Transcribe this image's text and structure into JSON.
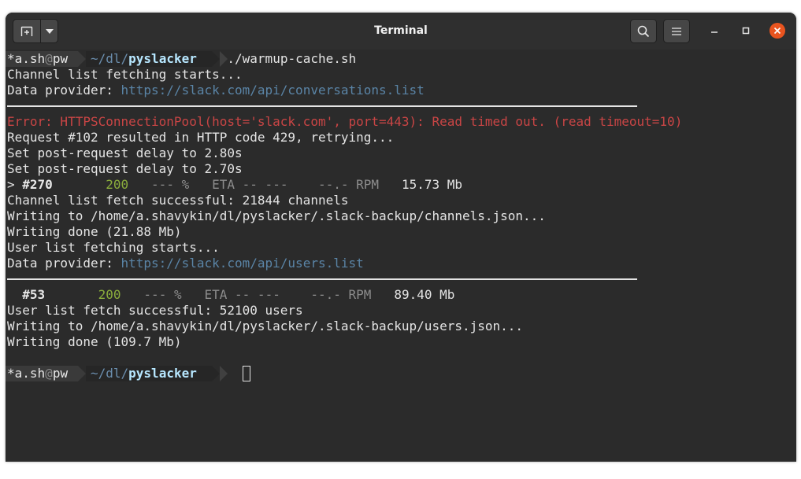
{
  "window": {
    "title": "Terminal",
    "colors": {
      "close": "#e9541f",
      "error": "#c94545",
      "success": "#8aac3c",
      "link": "#5a84a6"
    }
  },
  "titlebar": {
    "icons": [
      "new-tab-icon",
      "chevron-down-icon",
      "search-icon",
      "hamburger-menu-icon",
      "minimize-icon",
      "maximize-icon",
      "close-icon"
    ]
  },
  "prompt": {
    "user": "*a.sh",
    "at": "@",
    "host": "pw",
    "path_prefix": "~/dl/",
    "path_dir": "pyslacker"
  },
  "lines": {
    "command": "./warmup-cache.sh",
    "l1": "Channel list fetching starts...",
    "l2_label": "Data provider: ",
    "l2_url": "https://slack.com/api/conversations.list",
    "l3": "Error: HTTPSConnectionPool(host='slack.com', port=443): Read timed out. (read timeout=10)",
    "l4": "Request #102 resulted in HTTP code 429, retrying...",
    "l5": "Set post-request delay to 2.80s",
    "l6": "Set post-request delay to 2.70s",
    "p1_prefix": "> ",
    "p1_id": "#270",
    "p1_code": "200",
    "p1_pct": "--- %",
    "p1_eta": "ETA -- ---",
    "p1_rpm": "--.- RPM",
    "p1_size": "15.73 Mb",
    "l7": "Channel list fetch successful: 21844 channels",
    "l8": "Writing to /home/a.shavykin/dl/pyslacker/.slack-backup/channels.json...",
    "l9": "Writing done (21.88 Mb)",
    "l10": "User list fetching starts...",
    "l11_label": "Data provider: ",
    "l11_url": "https://slack.com/api/users.list",
    "p2_id": "#53",
    "p2_code": "200",
    "p2_pct": "--- %",
    "p2_eta": "ETA -- ---",
    "p2_rpm": "--.- RPM",
    "p2_size": "89.40 Mb",
    "l12": "User list fetch successful: 52100 users",
    "l13": "Writing to /home/a.shavykin/dl/pyslacker/.slack-backup/users.json...",
    "l14": "Writing done (109.7 Mb)"
  }
}
